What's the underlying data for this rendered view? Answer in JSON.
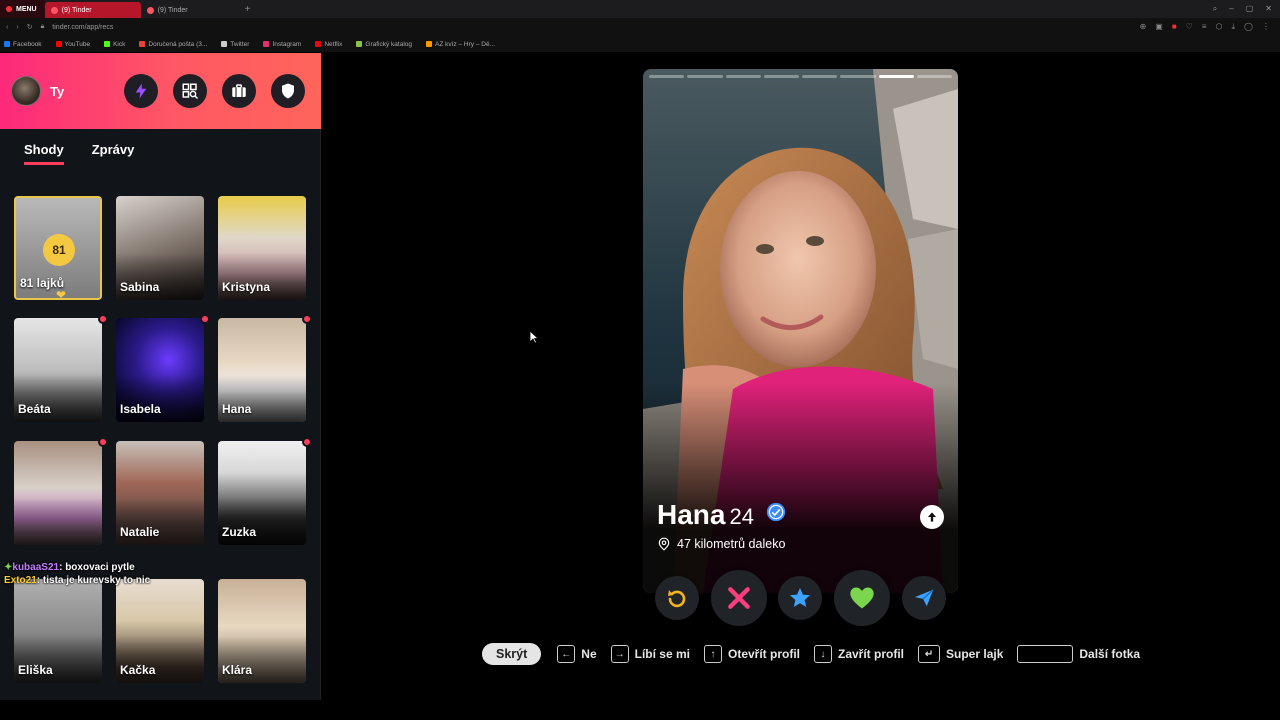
{
  "browser": {
    "menu_label": "MENU",
    "tabs": [
      {
        "title": "(9) Tinder",
        "active": true
      },
      {
        "title": "(9) Tinder",
        "active": false
      }
    ],
    "url": "tinder.com/app/recs"
  },
  "bookmarks": [
    {
      "label": "Facebook",
      "color": "#1877f2"
    },
    {
      "label": "YouTube",
      "color": "#ff0000"
    },
    {
      "label": "Kick",
      "color": "#53fc18"
    },
    {
      "label": "Doručená pošta (3...",
      "color": "#ea4335"
    },
    {
      "label": "Twitter",
      "color": "#cccccc"
    },
    {
      "label": "Instagram",
      "color": "#e1306c"
    },
    {
      "label": "Netflix",
      "color": "#e50914"
    },
    {
      "label": "Grafický katalog",
      "color": "#8bc34a"
    },
    {
      "label": "AZ kvíz – Hry – Dě...",
      "color": "#ff9800"
    }
  ],
  "sidebar": {
    "user_name": "Ty",
    "tabs": [
      {
        "label": "Shody",
        "active": true
      },
      {
        "label": "Zprávy",
        "active": false
      }
    ],
    "likes_count": "81",
    "likes_label": "81 lajků",
    "matches": [
      "Sabina",
      "Kristyna",
      "Beáta",
      "Isabela",
      "Hana",
      "Natalie",
      "Zuzka",
      "Eliška",
      "Kačka",
      "Klára"
    ],
    "chat_overlay": [
      {
        "user": "kubaaS21",
        "text": ": boxovaci pytle"
      },
      {
        "user": "Exto21",
        "text": ": tista je kurevsky to nic"
      }
    ]
  },
  "profile": {
    "name": "Hana",
    "age": "24",
    "distance": "47 kilometrů daleko",
    "photo_count": 8,
    "current_photo": 7
  },
  "shortcuts": {
    "hide_label": "Skrýt",
    "items": [
      "Ne",
      "Líbí se mi",
      "Otevřít profil",
      "Zavřít profil",
      "Super lajk",
      "Další fotka"
    ]
  },
  "colors": {
    "brand_start": "#fd297b",
    "brand_end": "#ff655b",
    "like": "#7cd64d",
    "nope": "#fd3d5e",
    "superlike": "#3ca4ff",
    "rewind": "#f5b31c",
    "boost": "#9b4dff"
  }
}
